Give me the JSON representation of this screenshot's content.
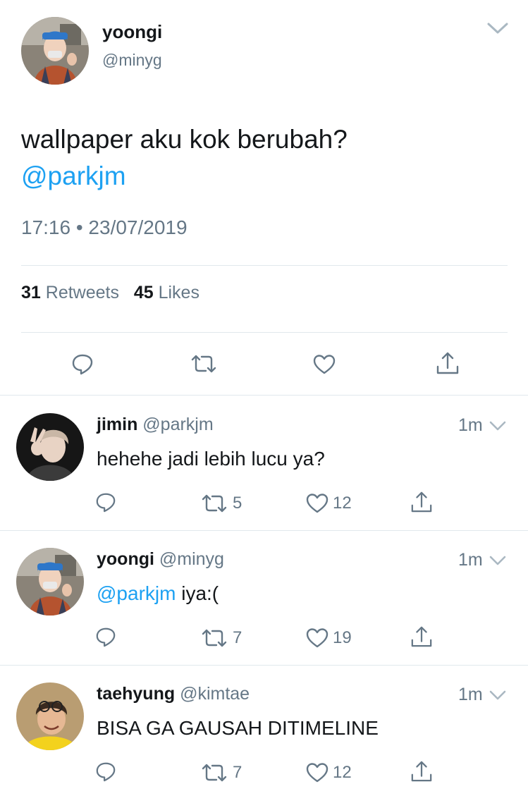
{
  "main_tweet": {
    "name": "yoongi",
    "handle": "@minyg",
    "text_before": "wallpaper aku kok berubah?",
    "mention": "@parkjm",
    "time": "17:16 • 23/07/2019",
    "retweets_count": "31",
    "retweets_label": "Retweets",
    "likes_count": "45",
    "likes_label": "Likes"
  },
  "replies": [
    {
      "name": "jimin",
      "handle": "@parkjm",
      "time": "1m",
      "mention": "",
      "text": "hehehe jadi lebih lucu ya?",
      "retweets": "5",
      "likes": "12"
    },
    {
      "name": "yoongi",
      "handle": "@minyg",
      "time": "1m",
      "mention": "@parkjm",
      "text": " iya:(",
      "retweets": "7",
      "likes": "19"
    },
    {
      "name": "taehyung",
      "handle": "@kimtae",
      "time": "1m",
      "mention": "",
      "text": "BISA GA GAUSAH DITIMELINE",
      "retweets": "7",
      "likes": "12"
    }
  ],
  "colors": {
    "accent": "#1da1f2",
    "secondary_text": "#657786",
    "primary_text": "#14171a",
    "divider": "#e1e8ed"
  },
  "icons": [
    "reply-icon",
    "retweet-icon",
    "like-icon",
    "share-icon",
    "chevron-down-icon"
  ]
}
